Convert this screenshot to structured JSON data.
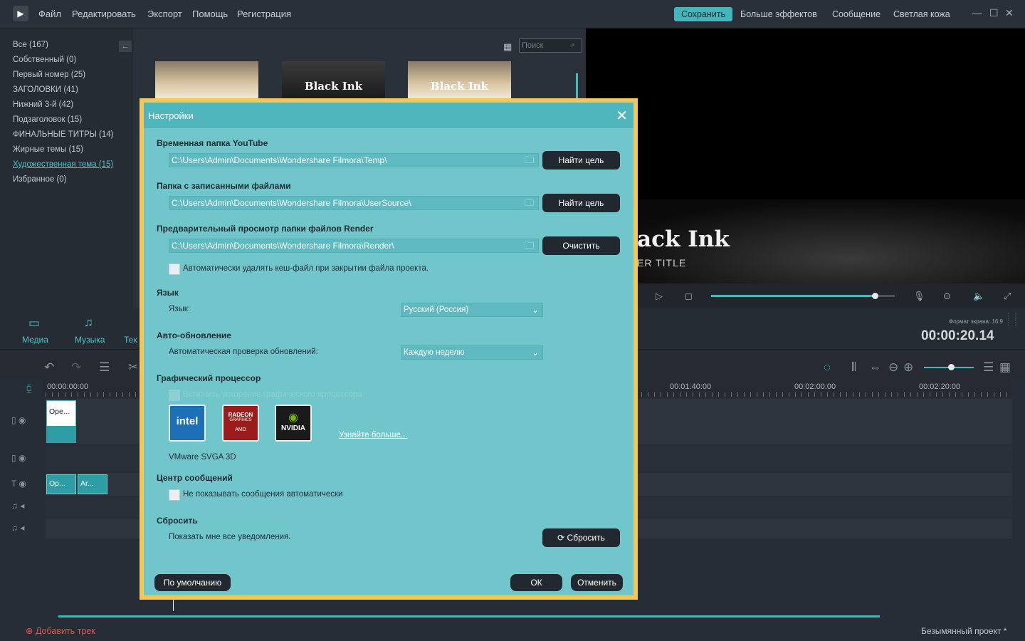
{
  "menu": [
    "Файл",
    "Редактировать",
    "Экспорт",
    "Помощь",
    "Регистрация"
  ],
  "top_right": {
    "save": "Сохранить",
    "effects": "Больше эффектов",
    "message": "Сообщение",
    "skin": "Светлая кожа"
  },
  "categories": [
    "Все (167)",
    "Собственный (0)",
    "Первый номер (25)",
    "ЗАГОЛОВКИ (41)",
    "Нижний 3-й (42)",
    "Подзаголовок (15)",
    "ФИНАЛЬНЫЕ ТИТРЫ (14)",
    "Жирные темы (15)",
    "Художественная тема (15)",
    "Избранное (0)"
  ],
  "active_category": "Художественная тема (15)",
  "search": {
    "placeholder": "Поиск"
  },
  "thumbs": [
    {
      "title": ""
    },
    {
      "title": "Black Ink"
    },
    {
      "title": "Black Ink"
    }
  ],
  "preview": {
    "title": "ack Ink",
    "subtitle": "ER TITLE",
    "progress": 0.9
  },
  "tabs": [
    "Медиа",
    "Музыка",
    "Тек"
  ],
  "ratio": "Формат экрана: 16:9",
  "timecode": "00:00:20.14",
  "ruler": [
    "00:00:00:00",
    "00:01:40:00",
    "00:02:00:00",
    "00:02:20:00"
  ],
  "clips": {
    "video": "Ope...",
    "text1": "Op...",
    "text2": "Ar..."
  },
  "add_track": "Добавить трек",
  "project": "Безымянный проект *",
  "dialog": {
    "title": "Настройки",
    "yt_label": "Временная папка YouTube",
    "yt_path": "C:\\Users\\Admin\\Documents\\Wondershare Filmora\\Temp\\",
    "find": "Найти цель",
    "rec_label": "Папка с записанными файлами",
    "rec_path": "C:\\Users\\Admin\\Documents\\Wondershare Filmora\\UserSource\\",
    "render_label": "Предварительный просмотр папки файлов Render",
    "render_path": "C:\\Users\\Admin\\Documents\\Wondershare Filmora\\Render\\",
    "clear": "Очистить",
    "auto_delete": "Автоматически удалять кеш-файл при закрытии файла проекта.",
    "lang_section": "Язык",
    "lang_label": "Язык:",
    "lang_value": "Русский (Россия)",
    "update_section": "Авто-обновление",
    "update_label": "Автоматическая проверка обновлений:",
    "update_value": "Каждую неделю",
    "gpu_section": "Графический процессор",
    "gpu_enable": "Включить ускорение графического процессора",
    "learn_more": "Узнайте больше...",
    "gpu_name": "VMware SVGA 3D",
    "msg_section": "Центр сообщений",
    "msg_label": "Не показывать сообщения автоматически",
    "reset_section": "Сбросить",
    "reset_label": "Показать мне все уведомления.",
    "reset_btn": "Сбросить",
    "default_btn": "По умолчанию",
    "ok_btn": "ОК",
    "cancel_btn": "Отменить",
    "gpu_logos": {
      "intel": "intel",
      "amd_top": "RADEON",
      "amd_mid": "GRAPHICS",
      "amd_bottom": "AMD",
      "nvidia": "NVIDIA"
    }
  }
}
